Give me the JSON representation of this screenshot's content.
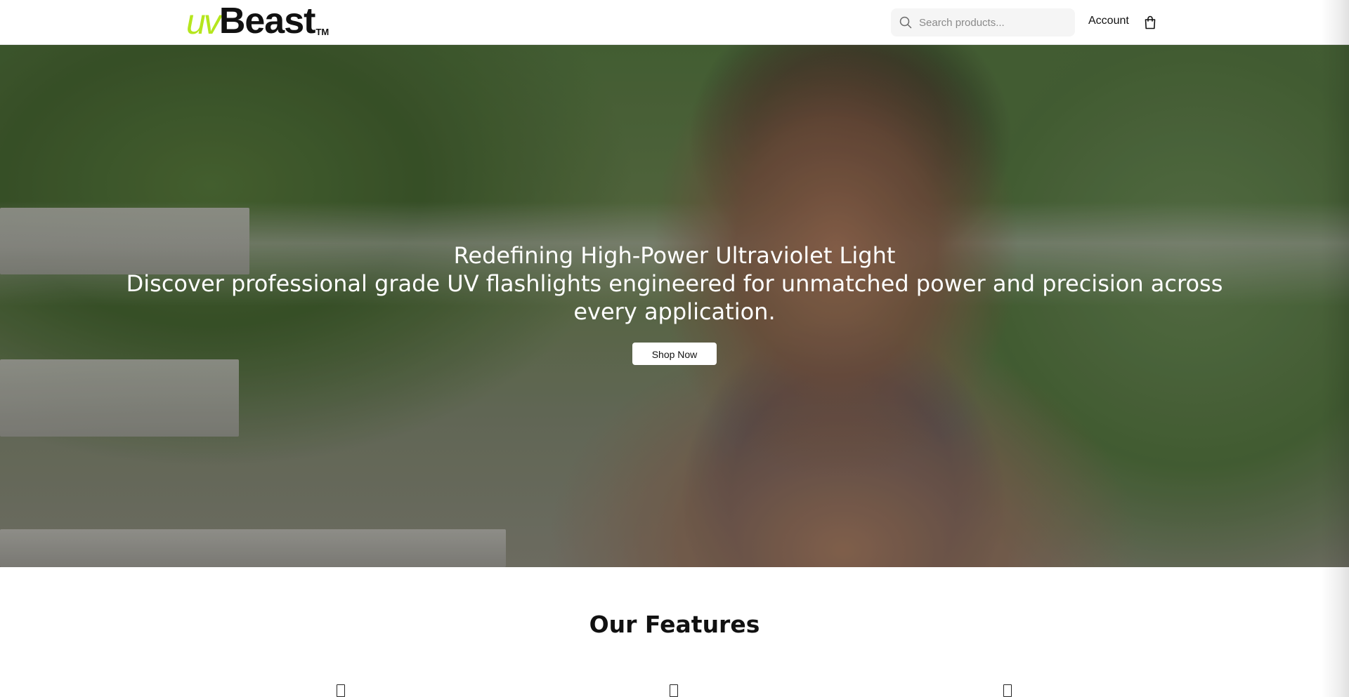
{
  "header": {
    "logo": {
      "uv": "uv",
      "beast": "Beast",
      "tm": "TM",
      "accent_color": "#b5e61d"
    },
    "search": {
      "placeholder": "Search products...",
      "icon": "search-icon"
    },
    "account_label": "Account",
    "cart_icon": "shopping-bag-icon"
  },
  "hero": {
    "title": "Redefining High-Power Ultraviolet Light",
    "subtitle": "Discover professional grade UV flashlights engineered for unmatched power and precision across every application.",
    "cta_label": "Shop Now"
  },
  "features": {
    "title": "Our Features",
    "icons": [
      "feature-icon",
      "feature-icon",
      "feature-icon"
    ]
  }
}
